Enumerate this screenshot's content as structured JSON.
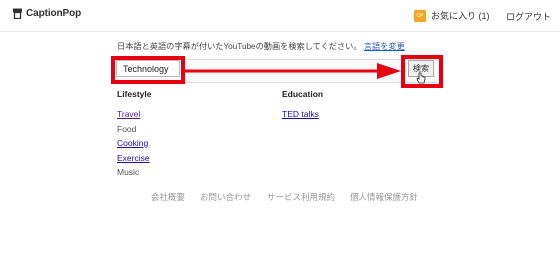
{
  "header": {
    "logo_text": "CaptionPop",
    "favorites_badge": "CP",
    "favorites_label": "お気に入り (1)",
    "logout_label": "ログアウト"
  },
  "search": {
    "instruction": "日本語と英語の字幕が付いたYouTubeの動画を検索してください。",
    "language_change_link": "言語を変更",
    "input_value": "Technology",
    "button_label": "検索"
  },
  "categories": {
    "lifestyle": {
      "heading": "Lifestyle",
      "items": [
        "Travel",
        "Food",
        "Cooking",
        "Exercise",
        "Music"
      ]
    },
    "education": {
      "heading": "Education",
      "items": [
        "TED talks"
      ]
    }
  },
  "footer": {
    "links": [
      "会社概要",
      "お問い合わせ",
      "サービス利用規約",
      "個人情報保護方針"
    ]
  },
  "colors": {
    "highlight": "#e60012",
    "favorites_badge": "#f5a623",
    "link": "#2457c5"
  }
}
